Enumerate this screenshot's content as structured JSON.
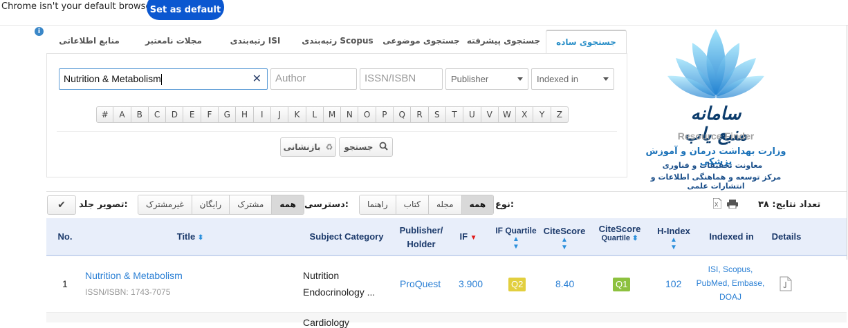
{
  "infobar": {
    "message": "Chrome isn't your default browser",
    "button": "Set as default"
  },
  "tabs": [
    {
      "label": "جستجوی ساده",
      "active": true
    },
    {
      "label": "جستجوی پیشرفته"
    },
    {
      "label": "جستجوی موضوعی"
    },
    {
      "label": "رتبه‌بندی Scopus"
    },
    {
      "label": "رتبه‌بندی ISI"
    },
    {
      "label": "مجلات نامعتبر"
    },
    {
      "label": "منابع اطلاعاتی"
    }
  ],
  "search": {
    "query": "Nutrition & Metabolism",
    "author_placeholder": "Author",
    "issn_placeholder": "ISSN/ISBN",
    "publisher_label": "Publisher",
    "indexed_label": "Indexed in",
    "search_button": "جستجو",
    "reset_button": "بازنشانی"
  },
  "alphabet": [
    "#",
    "A",
    "B",
    "C",
    "D",
    "E",
    "F",
    "G",
    "H",
    "I",
    "J",
    "K",
    "L",
    "M",
    "N",
    "O",
    "P",
    "Q",
    "R",
    "S",
    "T",
    "U",
    "V",
    "W",
    "X",
    "Y",
    "Z"
  ],
  "logo": {
    "title": "سامانه منبع یاب",
    "subtitle": "Resource Finder",
    "org_line1": "وزارت بهداشت درمان و آموزش پزشکی",
    "org_line2": "معاونت تحقیقات و فناوری",
    "org_line3": "مرکز توسعه و هماهنگی اطلاعات و انتشارات علمی",
    "colors": {
      "petal_light": "#7fd3f5",
      "petal_dark": "#1f7fd0",
      "text": "#0c3c6c"
    }
  },
  "filters": {
    "results_label": "تعداد نتایج: ۳۸",
    "type_label": "نوع:",
    "type_options": [
      "همه",
      "مجله",
      "کتاب",
      "راهنما"
    ],
    "type_selected": "همه",
    "access_label": "دسترسی:",
    "access_options": [
      "همه",
      "مشترک",
      "رایگان",
      "غیرمشترک"
    ],
    "access_selected": "همه",
    "cover_label": "تصویر جلد:"
  },
  "table": {
    "headers": {
      "details": "Details",
      "indexed": "Indexed in",
      "hindex": "H-Index",
      "cs_quartile_a": "CiteScore",
      "cs_quartile_b": "Quartile",
      "citescore": "CiteScore",
      "if_quartile": "IF Quartile",
      "if": "IF",
      "publisher_a": "Publisher/",
      "publisher_b": "Holder",
      "subject": "Subject Category",
      "title": "Title",
      "no": "No."
    },
    "rows": [
      {
        "no": "1",
        "title": "Nutrition & Metabolism",
        "issn": "ISSN/ISBN: 1743-7075",
        "subject_1": "Nutrition",
        "subject_2": "Endocrinology ...",
        "publisher": "ProQuest",
        "if": "3.900",
        "if_quartile": "Q2",
        "citescore": "8.40",
        "cs_quartile": "Q1",
        "hindex": "102",
        "indexed_1": "ISI, Scopus,",
        "indexed_2": "PubMed, Embase,",
        "indexed_3": "DOAJ"
      },
      {
        "subject_1": "Cardiology"
      }
    ]
  },
  "colors": {
    "accent": "#2a8fc8",
    "link": "#2a7fd4",
    "q2": "#e2cf3f",
    "q1": "#8dc13f",
    "header_bg": "#e8eefa"
  }
}
